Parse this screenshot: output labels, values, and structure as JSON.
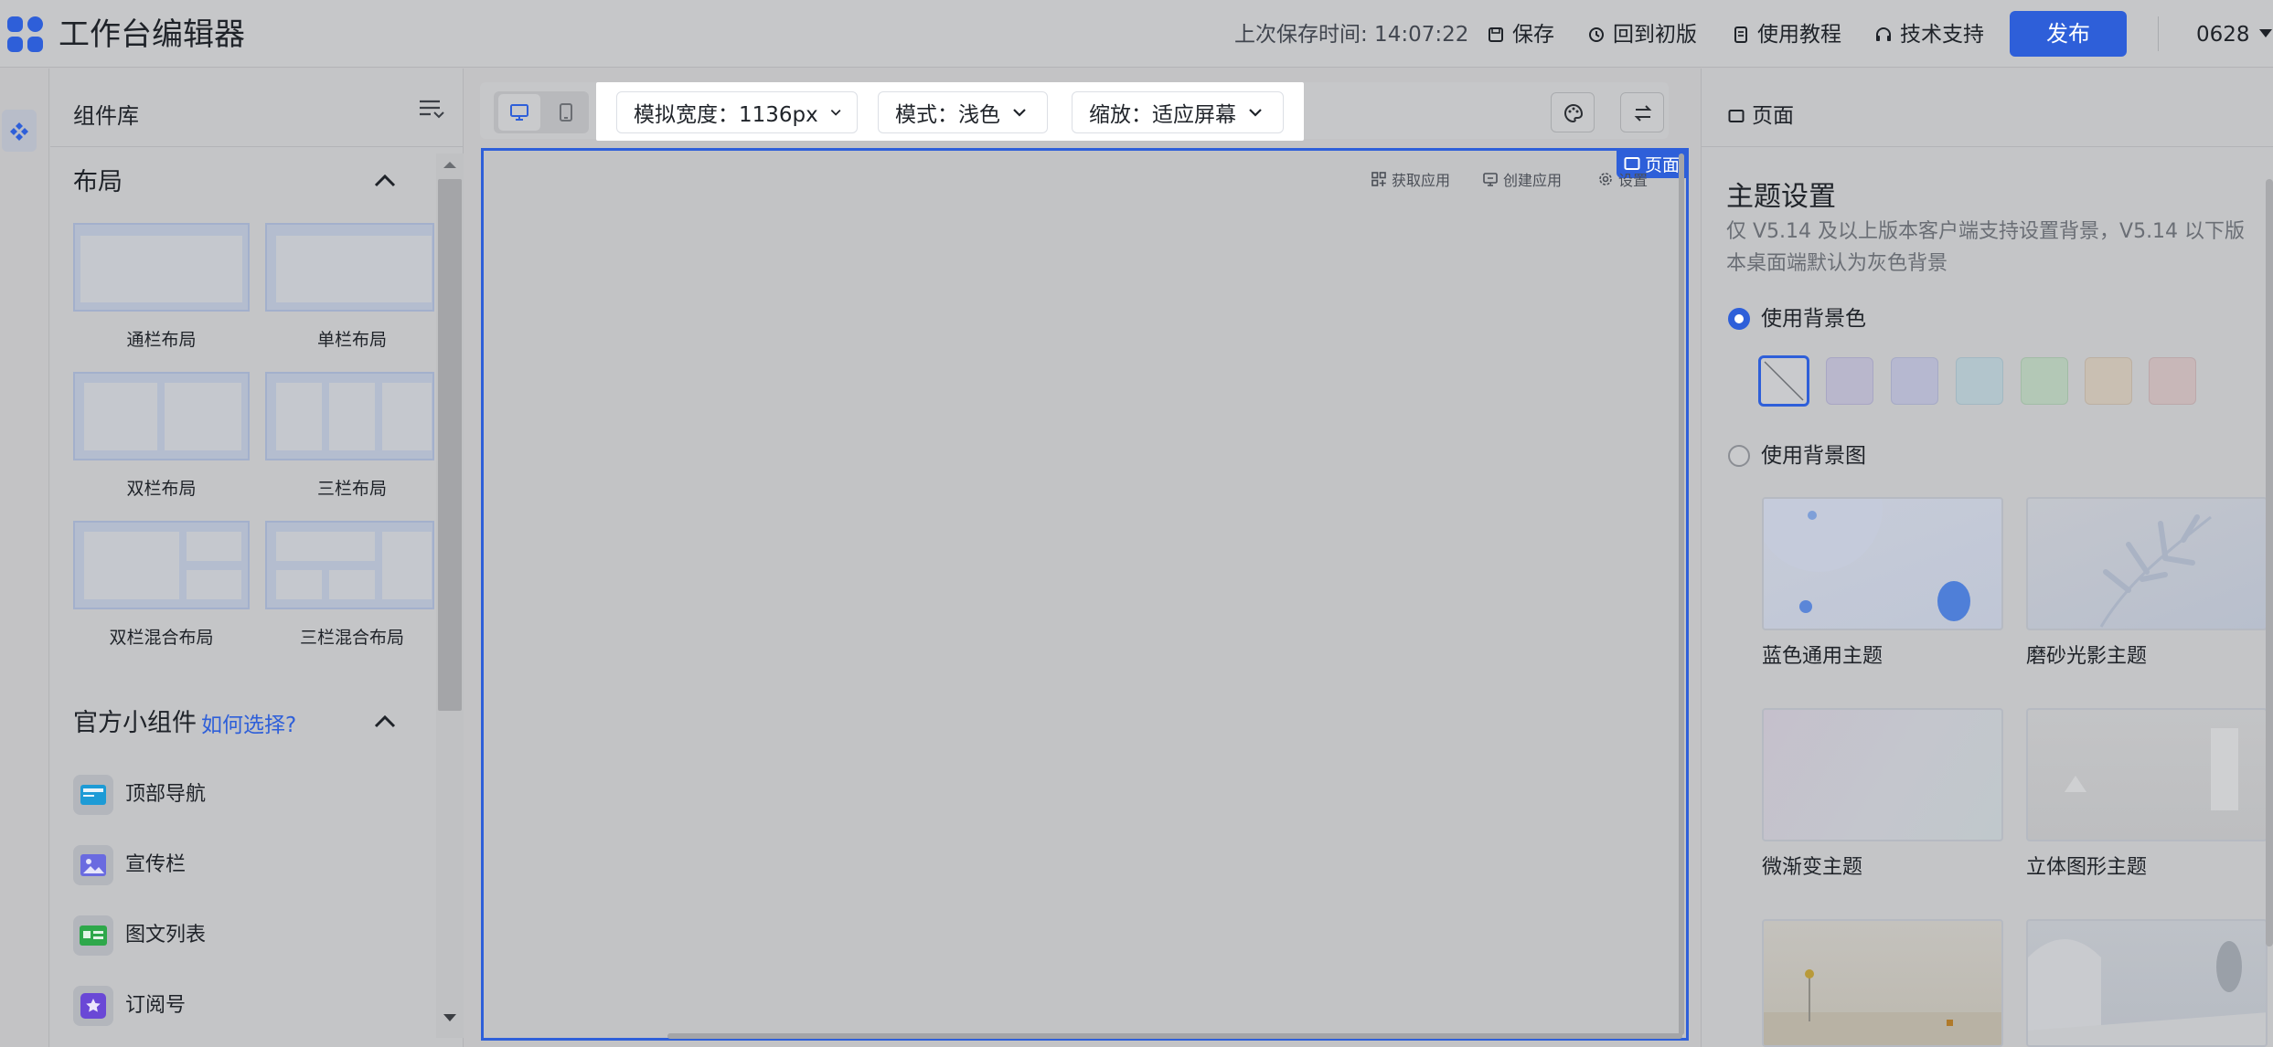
{
  "header": {
    "title": "工作台编辑器",
    "save_time": "上次保存时间: 14:07:22",
    "save": "保存",
    "revert": "回到初版",
    "tutorial": "使用教程",
    "support": "技术支持",
    "publish": "发布",
    "user": "0628"
  },
  "library": {
    "title": "组件库",
    "layout_section": "布局",
    "layouts": [
      "通栏布局",
      "单栏布局",
      "双栏布局",
      "三栏布局",
      "双栏混合布局",
      "三栏混合布局"
    ],
    "widgets_section": "官方小组件",
    "widgets_help": "如何选择?",
    "widgets": [
      {
        "label": "顶部导航",
        "icon": "top-nav-icon",
        "color": "#1d9bd6"
      },
      {
        "label": "宣传栏",
        "icon": "banner-icon",
        "color": "#6a6be0"
      },
      {
        "label": "图文列表",
        "icon": "image-text-list-icon",
        "color": "#2ea84b"
      },
      {
        "label": "订阅号",
        "icon": "subscription-icon",
        "color": "#6a48d6"
      }
    ]
  },
  "canvas": {
    "width_label": "模拟宽度：1136px",
    "mode_label": "模式：浅色",
    "zoom_label": "缩放：适应屏幕",
    "page_tag": "页面",
    "actions": [
      "获取应用",
      "创建应用",
      "设置"
    ]
  },
  "right": {
    "panel_title": "页面",
    "theme_title": "主题设置",
    "theme_desc": "仅 V5.14 及以上版本客户端支持设置背景，V5.14 以下版本桌面端默认为灰色背景",
    "bg_color_option": "使用背景色",
    "bg_image_option": "使用背景图",
    "swatches": [
      "#b9b7cc",
      "#b6b8d0",
      "#b2c5cc",
      "#b3c8b6",
      "#c9bfb2",
      "#c8b7b8"
    ],
    "themes": [
      "蓝色通用主题",
      "磨砂光影主题",
      "微渐变主题",
      "立体图形主题"
    ]
  },
  "colors": {
    "accent": "#2e5fd9",
    "help_link": "#2e5fd9"
  }
}
